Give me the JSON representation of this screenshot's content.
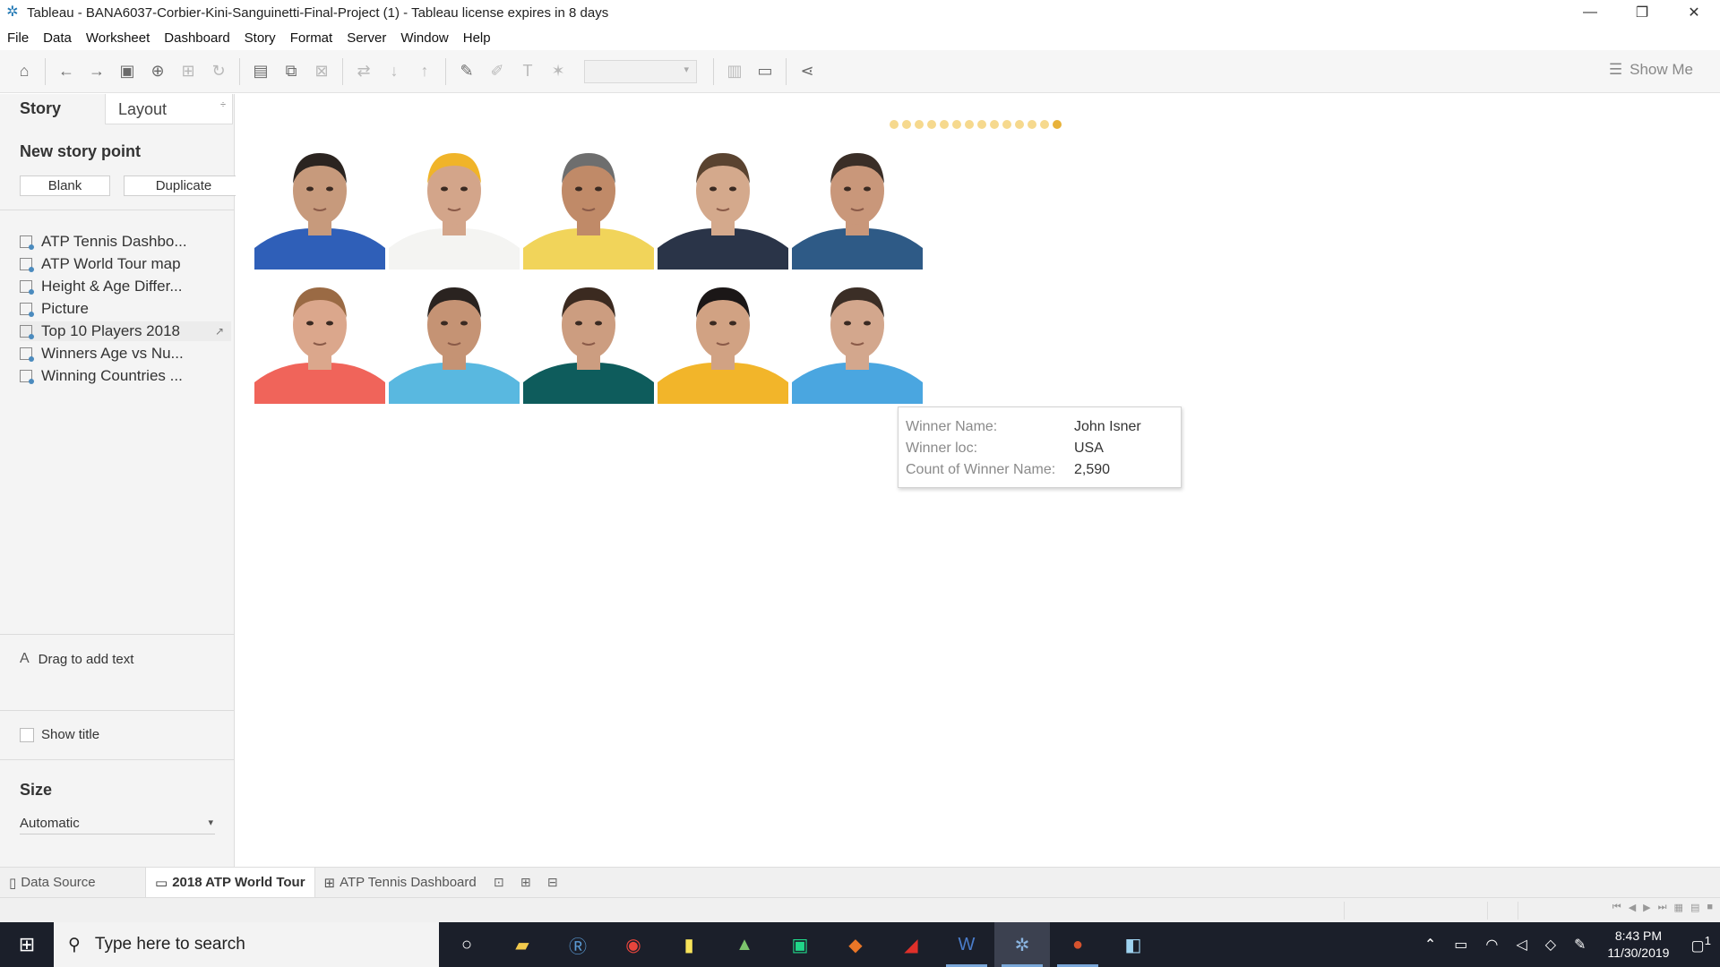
{
  "window": {
    "title": "Tableau - BANA6037-Corbier-Kini-Sanguinetti-Final-Project (1) - Tableau license expires in 8 days",
    "minimize": "—",
    "restore": "❐",
    "close": "✕"
  },
  "menu": [
    "File",
    "Data",
    "Worksheet",
    "Dashboard",
    "Story",
    "Format",
    "Server",
    "Window",
    "Help"
  ],
  "toolbar": {
    "show_me": "Show Me"
  },
  "left_pane": {
    "tab_story": "Story",
    "tab_layout": "Layout",
    "new_story_point": "New story point",
    "blank_button": "Blank",
    "duplicate_button": "Duplicate",
    "sheets": [
      {
        "label": "ATP Tennis Dashbo..."
      },
      {
        "label": "ATP World Tour map"
      },
      {
        "label": "Height & Age Differ..."
      },
      {
        "label": "Picture"
      },
      {
        "label": "Top 10 Players 2018"
      },
      {
        "label": "Winners Age vs Nu..."
      },
      {
        "label": "Winning Countries ..."
      }
    ],
    "drag_to_add_text": "Drag to add text",
    "show_title": "Show title",
    "size_title": "Size",
    "size_value": "Automatic"
  },
  "story": {
    "nav_point_count": 14,
    "current_point": 14,
    "player_photos": [
      {
        "shirt": "#2f5fb8",
        "skin": "#c79a7c",
        "hair": "#2b2420"
      },
      {
        "shirt": "#f4f4f2",
        "skin": "#d3a58a",
        "hair": "#f0b429"
      },
      {
        "shirt": "#f1d45a",
        "skin": "#c08a68",
        "hair": "#6e6e6e"
      },
      {
        "shirt": "#2a3448",
        "skin": "#d4a98c",
        "hair": "#5a4330"
      },
      {
        "shirt": "#2e5a86",
        "skin": "#c9977a",
        "hair": "#3a2e27"
      },
      {
        "shirt": "#f0645a",
        "skin": "#dba78c",
        "hair": "#9a6a44"
      },
      {
        "shirt": "#59b8e0",
        "skin": "#c59374",
        "hair": "#2a2320"
      },
      {
        "shirt": "#0e5c5c",
        "skin": "#cc9d80",
        "hair": "#3b2a20"
      },
      {
        "shirt": "#f2b52a",
        "skin": "#d1a283",
        "hair": "#1b1717"
      },
      {
        "shirt": "#4aa6e0",
        "skin": "#d3a78d",
        "hair": "#3b2e26"
      }
    ],
    "tooltip": {
      "rows": [
        {
          "key": "Winner Name:",
          "value": "John Isner"
        },
        {
          "key": "Winner loc:",
          "value": "USA"
        },
        {
          "key": "Count of Winner Name:",
          "value": "2,590"
        }
      ]
    }
  },
  "tabs": {
    "data_source": "Data Source",
    "story_tab": "2018 ATP World Tour",
    "dashboard_tab": "ATP Tennis Dashboard"
  },
  "taskbar": {
    "search_placeholder": "Type here to search",
    "time": "8:43 PM",
    "date": "11/30/2019",
    "notification_count": "1"
  }
}
